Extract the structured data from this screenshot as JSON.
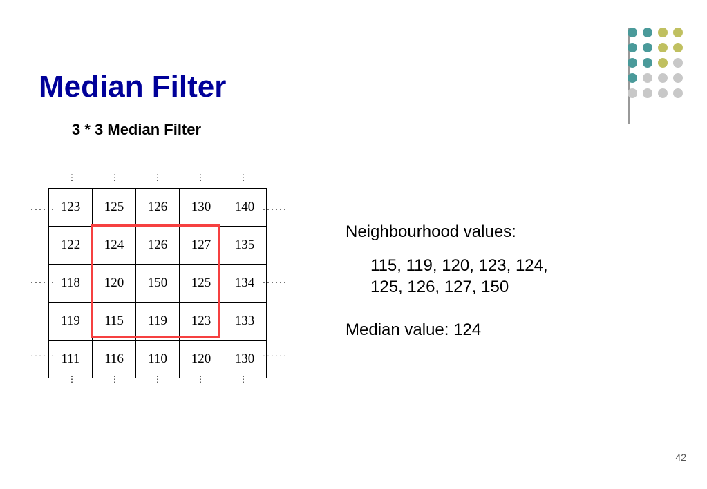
{
  "title": "Median Filter",
  "subtitle": "3 * 3 Median Filter",
  "page_number": "42",
  "grid": {
    "rows": [
      [
        "123",
        "125",
        "126",
        "130",
        "140"
      ],
      [
        "122",
        "124",
        "126",
        "127",
        "135"
      ],
      [
        "118",
        "120",
        "150",
        "125",
        "134"
      ],
      [
        "119",
        "115",
        "119",
        "123",
        "133"
      ],
      [
        "111",
        "116",
        "110",
        "120",
        "130"
      ]
    ],
    "selection": {
      "row_start": 1,
      "col_start": 1,
      "size": 3
    }
  },
  "neighbourhood": {
    "label": "Neighbourhood values:",
    "values_line1": "115, 119, 120, 123, 124,",
    "values_line2": "125, 126, 127, 150"
  },
  "median": {
    "label": "Median value:",
    "value": "124"
  },
  "decor_colors": {
    "teal": "#4a9a9a",
    "olive": "#c0c060",
    "gray": "#c8c8c8"
  }
}
